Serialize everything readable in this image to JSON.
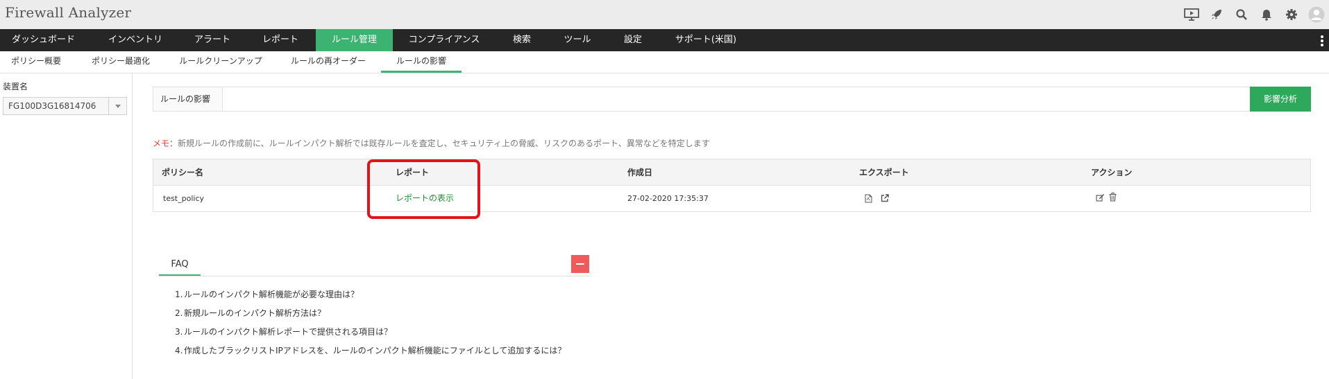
{
  "header": {
    "title": "Firewall Analyzer",
    "icons": [
      "presentation-icon",
      "rocket-icon",
      "search-icon",
      "bell-icon",
      "gear-icon",
      "user-avatar-icon"
    ]
  },
  "mainnav": {
    "items": [
      {
        "label": "ダッシュボード"
      },
      {
        "label": "インベントリ"
      },
      {
        "label": "アラート"
      },
      {
        "label": "レポート"
      },
      {
        "label": "ルール管理",
        "active": true
      },
      {
        "label": "コンプライアンス"
      },
      {
        "label": "検索"
      },
      {
        "label": "ツール"
      },
      {
        "label": "設定"
      },
      {
        "label": "サポート(米国)"
      }
    ]
  },
  "subnav": {
    "items": [
      {
        "label": "ポリシー概要"
      },
      {
        "label": "ポリシー最適化"
      },
      {
        "label": "ルールクリーンアップ"
      },
      {
        "label": "ルールの再オーダー"
      },
      {
        "label": "ルールの影響",
        "active": true
      }
    ]
  },
  "leftpanel": {
    "device_label": "装置名",
    "device_value": "FG100D3G16814706"
  },
  "rule_bar": {
    "label": "ルールの影響",
    "input_value": "",
    "button_label": "影響分析"
  },
  "memo": {
    "label": "メモ：",
    "text": "新規ルールの作成前に、ルールインパクト解析では既存ルールを査定し、セキュリティ上の脅威、リスクのあるポート、異常などを特定します"
  },
  "table": {
    "headers": {
      "policy": "ポリシー名",
      "report": "レポート",
      "created": "作成日",
      "export": "エクスポート",
      "action": "アクション"
    },
    "rows": [
      {
        "policy": "test_policy",
        "report": "レポートの表示",
        "created": "27-02-2020 17:35:37"
      }
    ]
  },
  "faq": {
    "tab_label": "FAQ",
    "items": [
      {
        "num": "1.",
        "text": "ルールのインパクト解析機能が必要な理由は？"
      },
      {
        "num": "2.",
        "text": "新規ルールのインパクト解析方法は？"
      },
      {
        "num": "3.",
        "text": "ルールのインパクト解析レポートで提供される項目は？"
      },
      {
        "num": "4.",
        "text": "作成したブラックリストIPアドレスを、ルールのインパクト解析機能にファイルとして追加するには？"
      }
    ]
  },
  "colors": {
    "accent": "#3cb371",
    "nav_bg": "#262626",
    "button": "#2ea85a",
    "memo_label": "#e53935",
    "link": "#1e8c2e",
    "highlight": "#e3131b",
    "collapse": "#ef5a5a"
  }
}
